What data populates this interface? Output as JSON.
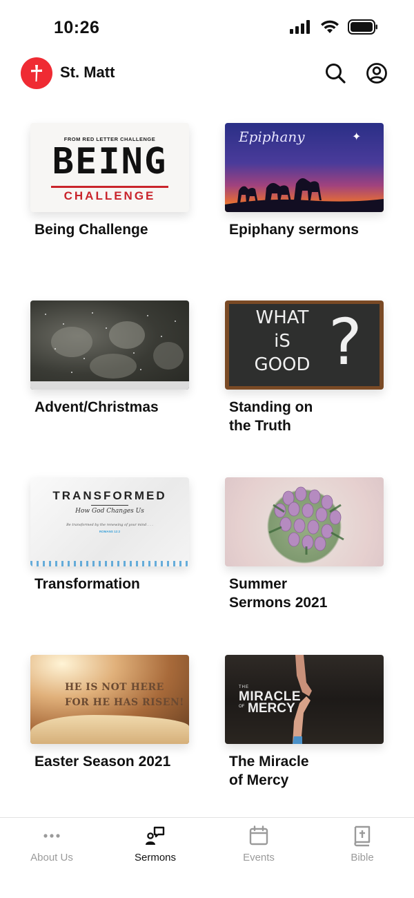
{
  "status_bar": {
    "time": "10:26"
  },
  "header": {
    "church_name": "St. Matt",
    "brand_color": "#ef2b33"
  },
  "series": [
    {
      "title": "Being Challenge",
      "thumb": {
        "small": "FROM RED LETTER CHALLENGE",
        "big": "BEING",
        "tag": "CHALLENGE"
      }
    },
    {
      "title": "Epiphany sermons",
      "thumb": {
        "script": "Epiphany"
      }
    },
    {
      "title": "Advent/Christmas",
      "thumb": {}
    },
    {
      "title": "Standing on\nthe Truth",
      "thumb": {
        "line1": "WHAT",
        "line2": "iS",
        "line3": "GOOD",
        "mark": "?"
      }
    },
    {
      "title": "Transformation",
      "thumb": {
        "heading": "TRANSFORMED",
        "sub": "How God Changes Us",
        "verse": "Be transformed by the renewing of your mind . . .",
        "ref": "ROMANS 12:2"
      }
    },
    {
      "title": "Summer\nSermons 2021",
      "thumb": {}
    },
    {
      "title": "Easter Season 2021",
      "thumb": {
        "line1": "HE IS NOT HERE",
        "line2": "FOR HE HAS RISEN!"
      }
    },
    {
      "title": "The Miracle\nof Mercy",
      "thumb": {
        "the": "THE",
        "miracle": "MIRACLE",
        "of": "OF",
        "mercy": "MERCY"
      }
    }
  ],
  "tabs": [
    {
      "label": "About Us",
      "icon": "more-dots-icon",
      "active": false
    },
    {
      "label": "Sermons",
      "icon": "sermons-icon",
      "active": true
    },
    {
      "label": "Events",
      "icon": "calendar-icon",
      "active": false
    },
    {
      "label": "Bible",
      "icon": "bible-icon",
      "active": false
    }
  ]
}
